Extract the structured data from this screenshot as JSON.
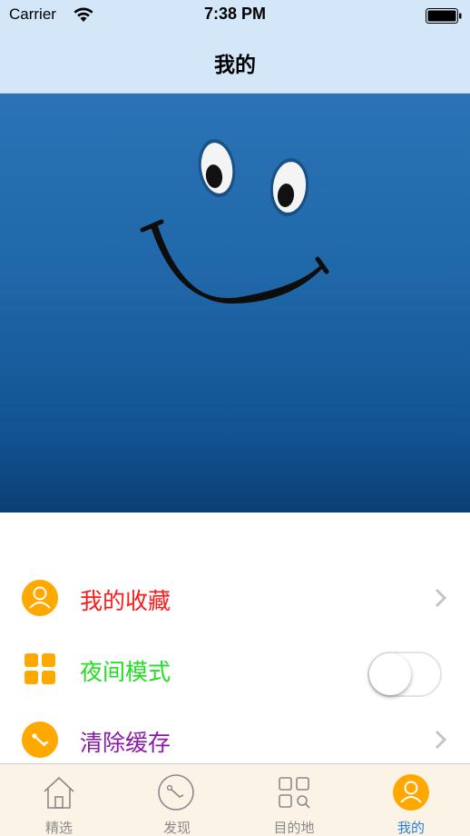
{
  "status_bar": {
    "carrier": "Carrier",
    "time": "7:38 PM"
  },
  "nav": {
    "title": "我的"
  },
  "menu": {
    "items": [
      {
        "label": "我的收藏",
        "color": "#ff1a1a",
        "icon": "user-circle-icon"
      },
      {
        "label": "夜间模式",
        "color": "#22dd22",
        "icon": "grid-icon",
        "toggle_on": false
      },
      {
        "label": "清除缓存",
        "color": "#8a1ba8",
        "icon": "broom-icon"
      }
    ]
  },
  "tabbar": {
    "tabs": [
      {
        "label": "精选",
        "icon": "home-icon",
        "active": false
      },
      {
        "label": "发现",
        "icon": "compass-icon",
        "active": false
      },
      {
        "label": "目的地",
        "icon": "apps-grid-icon",
        "active": false
      },
      {
        "label": "我的",
        "icon": "profile-icon",
        "active": true
      }
    ]
  },
  "colors": {
    "accent_orange": "#ffa800",
    "active_blue": "#2b7fd6",
    "nav_bg": "#d3e7f8"
  }
}
